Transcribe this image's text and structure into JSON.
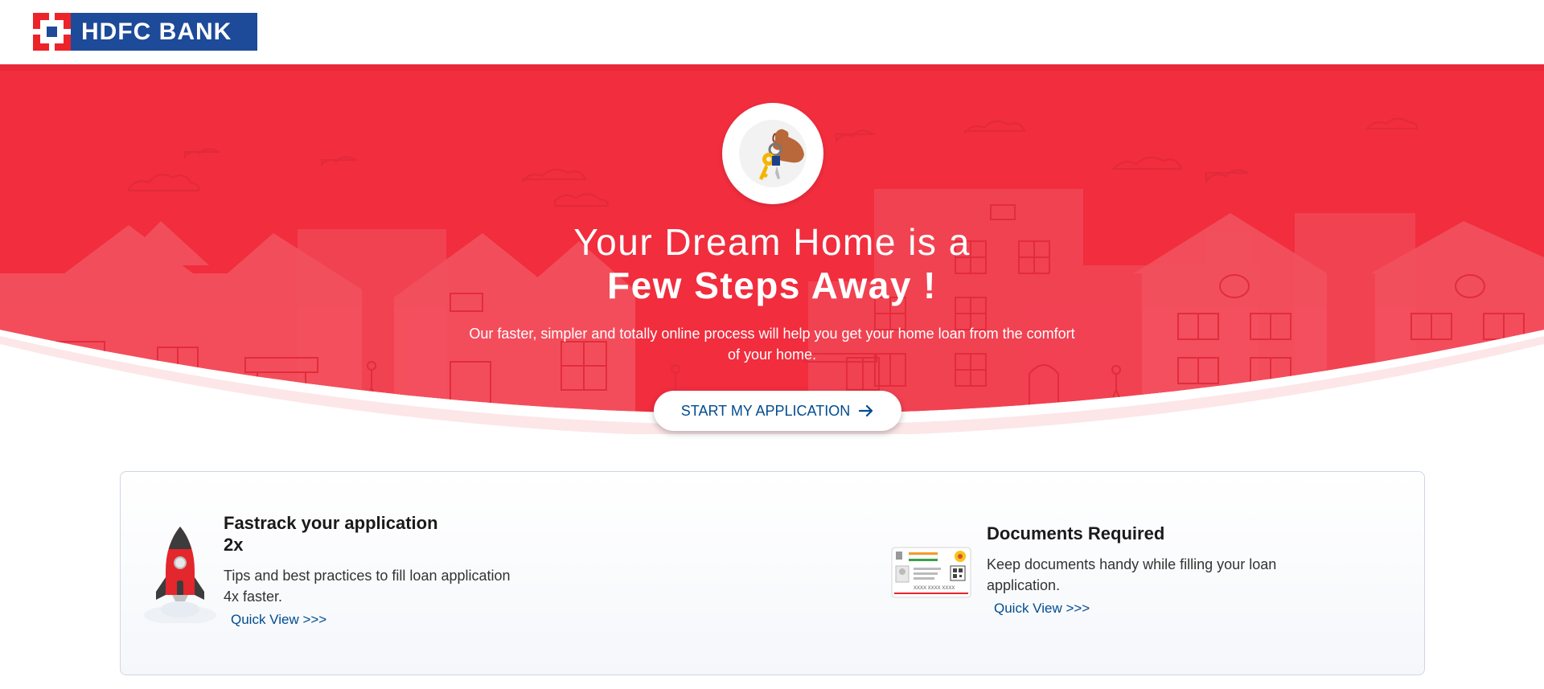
{
  "header": {
    "logo_text": "HDFC BANK"
  },
  "hero": {
    "title_line1": "Your Dream Home is a",
    "title_line2": "Few Steps Away !",
    "subtitle": "Our faster, simpler and totally online process will help you get your home loan from the comfort of your home.",
    "cta_label": "START MY APPLICATION"
  },
  "features": [
    {
      "title_line1": "Fastrack your application",
      "title_line2": "2x",
      "description": "Tips and best practices to fill loan application 4x faster.",
      "link": "Quick View >>>"
    },
    {
      "title": "Documents Required",
      "description": "Keep documents handy while filling your loan application.",
      "link": "Quick View >>>",
      "card_number": "XXXX XXXX XXXX"
    }
  ],
  "colors": {
    "brand_red": "#ed232a",
    "hero_red": "#f12d3e",
    "brand_blue": "#1d4a99",
    "link_blue": "#004c8f"
  }
}
